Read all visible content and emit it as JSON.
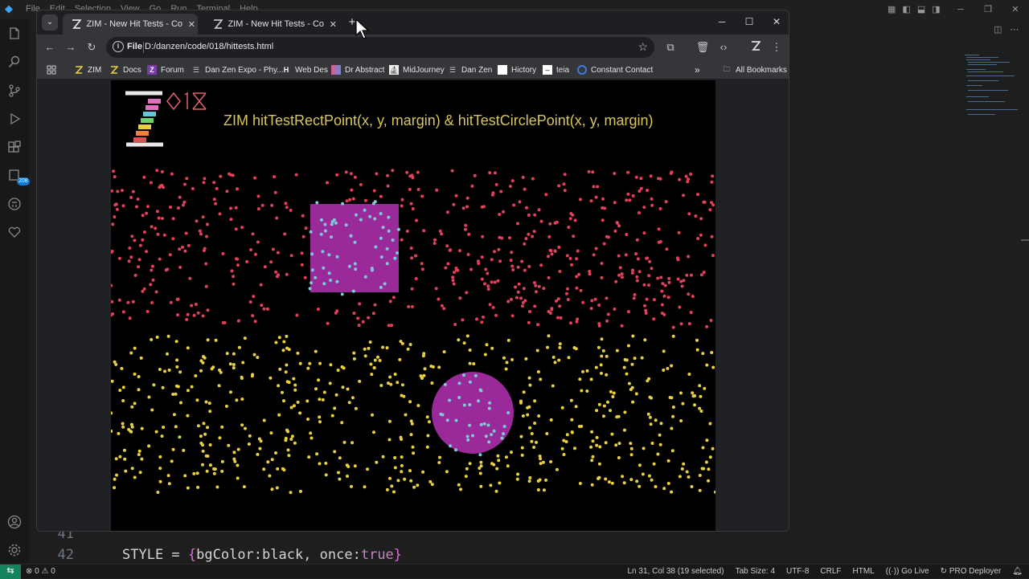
{
  "vscode": {
    "menu": [
      "File",
      "Edit",
      "Selection",
      "View",
      "Go",
      "Run",
      "Terminal",
      "Help"
    ],
    "activity_badge": "208",
    "code_lines": [
      {
        "num": "41",
        "text": ""
      },
      {
        "num": "42",
        "text_parts": {
          "a": "STYLE = ",
          "b": "{",
          "c": "bgColor:black, once:",
          "d": "true",
          "e": "}"
        }
      }
    ],
    "status": {
      "problems": "⊗ 0 ⚠ 0",
      "position": "Ln 31, Col 38 (19 selected)",
      "tab_size": "Tab Size: 4",
      "encoding": "UTF-8",
      "eol": "CRLF",
      "language": "HTML",
      "go_live": "Go Live",
      "deployer": "PRO Deployer"
    }
  },
  "browser": {
    "tabs": [
      {
        "title": "ZIM - New Hit Tests - Code Cre",
        "active": true
      },
      {
        "title": "ZIM - New Hit Tests - Code Cre",
        "active": false
      }
    ],
    "address": {
      "scheme": "File",
      "url": "D:/danzen/code/018/hittests.html"
    },
    "bookmarks": [
      {
        "label": "ZIM",
        "icon": "zim-icon"
      },
      {
        "label": "Docs",
        "icon": "zim-icon"
      },
      {
        "label": "Forum",
        "icon": "z-icon"
      },
      {
        "label": "Dan Zen Expo - Phy...",
        "icon": "page-icon"
      },
      {
        "label": "Web Des",
        "icon": "h-icon"
      },
      {
        "label": "Dr Abstract",
        "icon": "abstract-icon"
      },
      {
        "label": "MidJourney",
        "icon": "midjourney-icon"
      },
      {
        "label": "Dan Zen",
        "icon": "page-icon"
      },
      {
        "label": "Hictory",
        "icon": "blank-icon"
      },
      {
        "label": "teia",
        "icon": "teia-icon"
      },
      {
        "label": "Constant Contact",
        "icon": "cc-icon"
      }
    ],
    "all_bookmarks": "All Bookmarks"
  },
  "stage": {
    "title": "ZIM hitTestRectPoint(x, y, margin) & hitTestCirclePoint(x, y, margin)",
    "logo_text": "ZIM",
    "logo_version": "018",
    "colors": {
      "background": "#000000",
      "title": "#d8c65a",
      "red_dots": "#e0405a",
      "yellow_dots": "#e8d040",
      "shape_fill": "#9a2a9a",
      "hit_dots": "#7ec8d8"
    }
  }
}
